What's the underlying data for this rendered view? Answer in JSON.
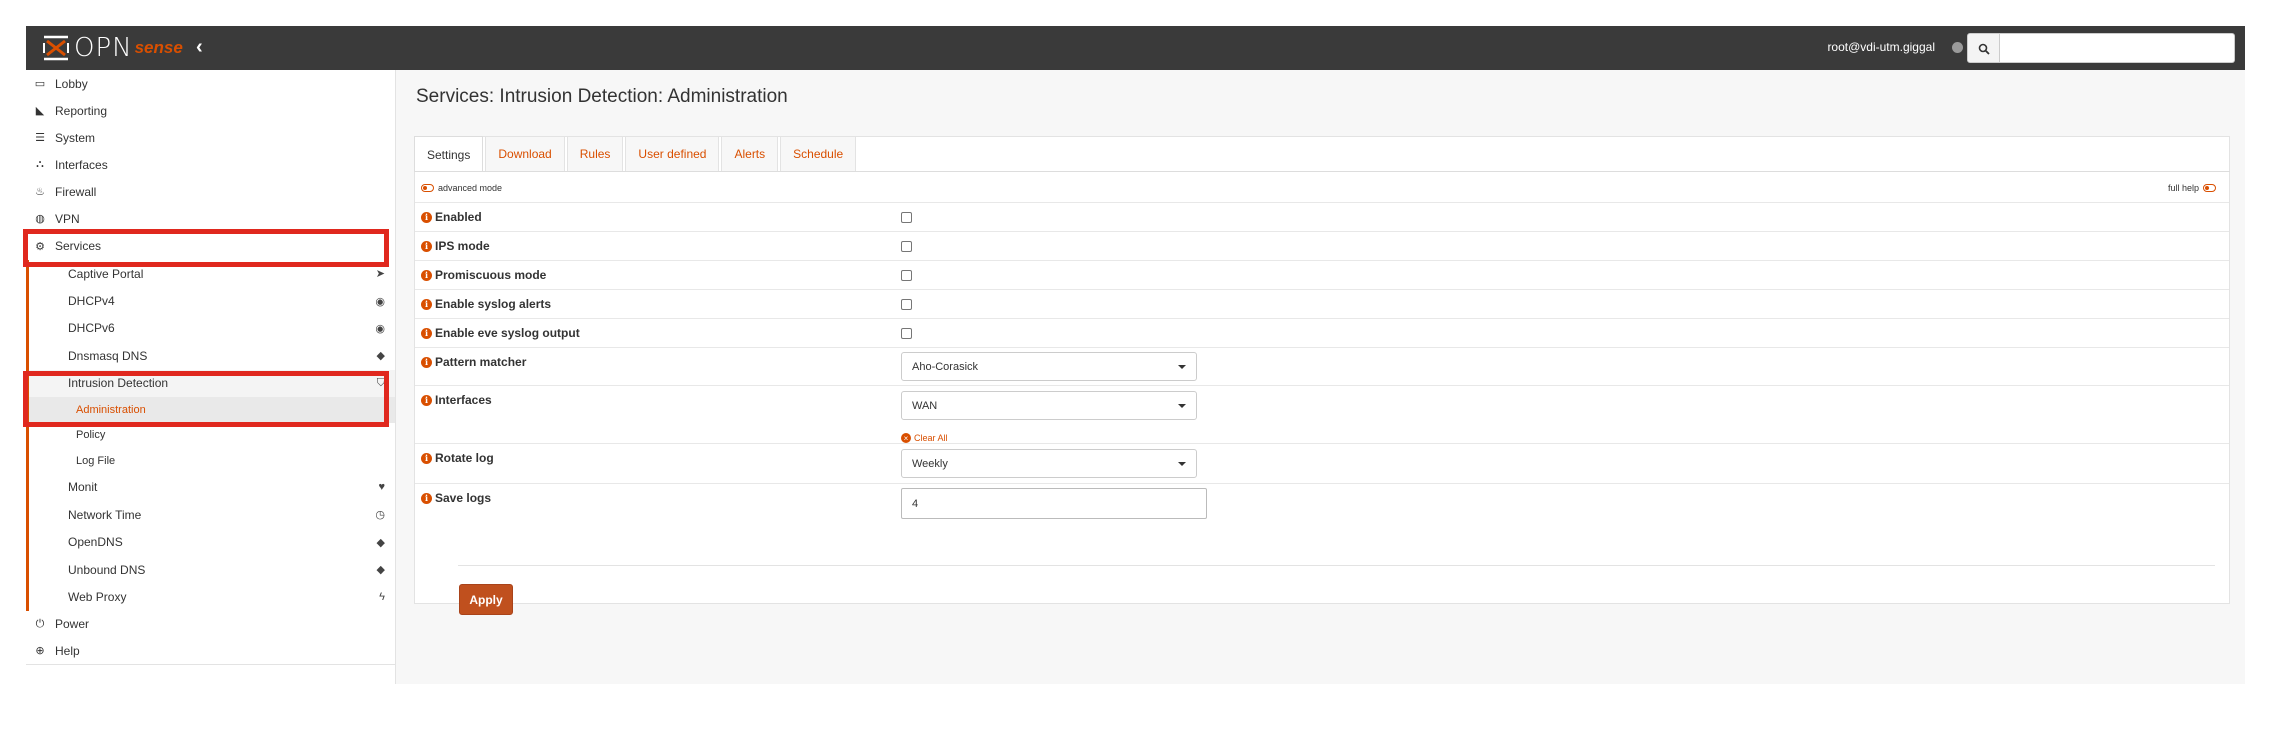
{
  "brand": {
    "logo_text": "OPN",
    "logo_sense": "sense"
  },
  "header": {
    "user": "root@vdi-utm.giggal",
    "search_placeholder": ""
  },
  "sidebar": {
    "top_items": [
      {
        "label": "Lobby",
        "icon": "laptop-icon"
      },
      {
        "label": "Reporting",
        "icon": "area-chart-icon"
      },
      {
        "label": "System",
        "icon": "server-icon"
      },
      {
        "label": "Interfaces",
        "icon": "sitemap-icon"
      },
      {
        "label": "Firewall",
        "icon": "fire-icon"
      },
      {
        "label": "VPN",
        "icon": "globe-icon"
      },
      {
        "label": "Services",
        "icon": "cog-icon"
      }
    ],
    "services": [
      {
        "label": "Captive Portal",
        "icon": "paper-plane-icon"
      },
      {
        "label": "DHCPv4",
        "icon": "bullseye-icon"
      },
      {
        "label": "DHCPv6",
        "icon": "bullseye-icon"
      },
      {
        "label": "Dnsmasq DNS",
        "icon": "tags-icon"
      },
      {
        "label": "Intrusion Detection",
        "icon": "shield-icon"
      }
    ],
    "ids_children": [
      {
        "label": "Administration"
      },
      {
        "label": "Policy"
      },
      {
        "label": "Log File"
      }
    ],
    "services_more": [
      {
        "label": "Monit",
        "icon": "heartbeat-icon"
      },
      {
        "label": "Network Time",
        "icon": "clock-icon"
      },
      {
        "label": "OpenDNS",
        "icon": "tags-icon"
      },
      {
        "label": "Unbound DNS",
        "icon": "tags-icon"
      },
      {
        "label": "Web Proxy",
        "icon": "bolt-icon"
      }
    ],
    "bottom_items": [
      {
        "label": "Power",
        "icon": "plug-icon"
      },
      {
        "label": "Help",
        "icon": "life-ring-icon"
      }
    ]
  },
  "page": {
    "title": "Services: Intrusion Detection: Administration"
  },
  "tabs": [
    "Settings",
    "Download",
    "Rules",
    "User defined",
    "Alerts",
    "Schedule"
  ],
  "form": {
    "advanced_mode": "advanced mode",
    "full_help": "full help",
    "fields": {
      "enabled": "Enabled",
      "ips": "IPS mode",
      "promisc": "Promiscuous mode",
      "syslog": "Enable syslog alerts",
      "eve": "Enable eve syslog output",
      "pattern": "Pattern matcher",
      "interfaces": "Interfaces",
      "rotate": "Rotate log",
      "savelogs": "Save logs"
    },
    "values": {
      "pattern": "Aho-Corasick",
      "interfaces": "WAN",
      "rotate": "Weekly",
      "savelogs": "4"
    },
    "clear_all": "Clear All",
    "apply": "Apply"
  },
  "colors": {
    "accent": "#d94f00",
    "highlight": "#e0281e",
    "topbar": "#3a3a3a"
  }
}
